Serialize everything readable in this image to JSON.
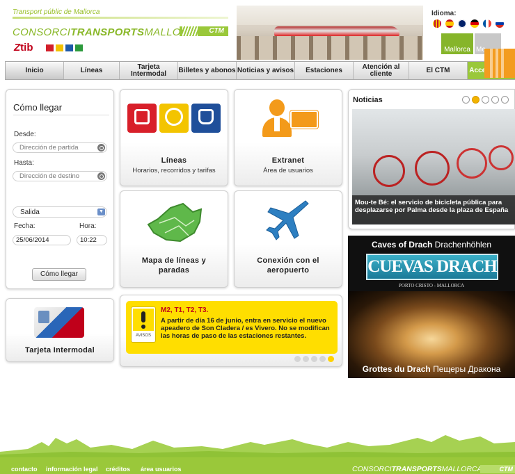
{
  "header": {
    "tagline": "Transport públic de Mallorca",
    "brand_light": "CONSORCI",
    "brand_bold": "TRANSPORTS",
    "brand_end": "MALLORCA",
    "ctm": "CTM",
    "tib": "tib",
    "idioma_label": "Idioma:",
    "mallorca_button": "Mallorca",
    "mallorca_button_2": "Me",
    "brand_green": "#9ac83a",
    "flags": [
      "catalan-flag-icon",
      "spanish-flag-icon",
      "uk-flag-icon",
      "german-flag-icon",
      "french-flag-icon",
      "russian-flag-icon"
    ]
  },
  "nav": {
    "items": [
      {
        "label": "Inicio"
      },
      {
        "label": "Líneas"
      },
      {
        "label": "Tarjeta Intermodal"
      },
      {
        "label": "Billetes y abonos"
      },
      {
        "label": "Noticias y avisos"
      },
      {
        "label": "Estaciones"
      },
      {
        "label": "Atención al cliente"
      },
      {
        "label": "El CTM"
      },
      {
        "label": "Accesibilidad"
      }
    ]
  },
  "route_planner": {
    "title": "Cómo llegar",
    "desde_label": "Desde:",
    "desde_placeholder": "Dirección de partida",
    "hasta_label": "Hasta:",
    "hasta_placeholder": "Dirección de destino",
    "mode_value": "Salida",
    "fecha_label": "Fecha:",
    "fecha_value": "25/06/2014",
    "hora_label": "Hora:",
    "hora_value": "10:22",
    "submit_label": "Cómo llegar"
  },
  "tarjeta": {
    "title": "Tarjeta Intermodal"
  },
  "tiles": {
    "lineas": {
      "title": "Líneas",
      "subtitle": "Horarios, recorridos y tarifas"
    },
    "extranet": {
      "title": "Extranet",
      "subtitle": "Área de usuarios"
    },
    "mapa": {
      "title": "Mapa de líneas y paradas"
    },
    "aero": {
      "title": "Conexión con el aeropuerto"
    }
  },
  "avisos": {
    "icon_label": "AVISOS",
    "title": "M2, T1, T2, T3.",
    "text": "A partir de día 16 de junio, entra en servicio el nuevo apeadero de Son Cladera / es Vivero. No se modifican las horas de paso de las estaciones restantes.",
    "accent": "#ffde00"
  },
  "noticias": {
    "title": "Noticias",
    "caption": "Mou-te Bé: el servicio de bicicleta pública para desplazarse por Palma desde la plaza de España"
  },
  "ad": {
    "top_bold": "Caves of Drach",
    "top_rest": " Drachenhöhlen",
    "logo": "CUEVAS DRACH",
    "logo_mid": "del",
    "sub": "PORTO CRISTO - MALLORCA",
    "bottom_bold": "Grottes du Drach",
    "bottom_rest": " Пещеры Дракона"
  },
  "footer": {
    "links": [
      "contacto",
      "información legal",
      "créditos",
      "área usuarios"
    ],
    "brand_light": "CONSORCI",
    "brand_bold": "TRANSPORTS",
    "brand_end": "MALLORCA",
    "ctm": "CTM"
  }
}
